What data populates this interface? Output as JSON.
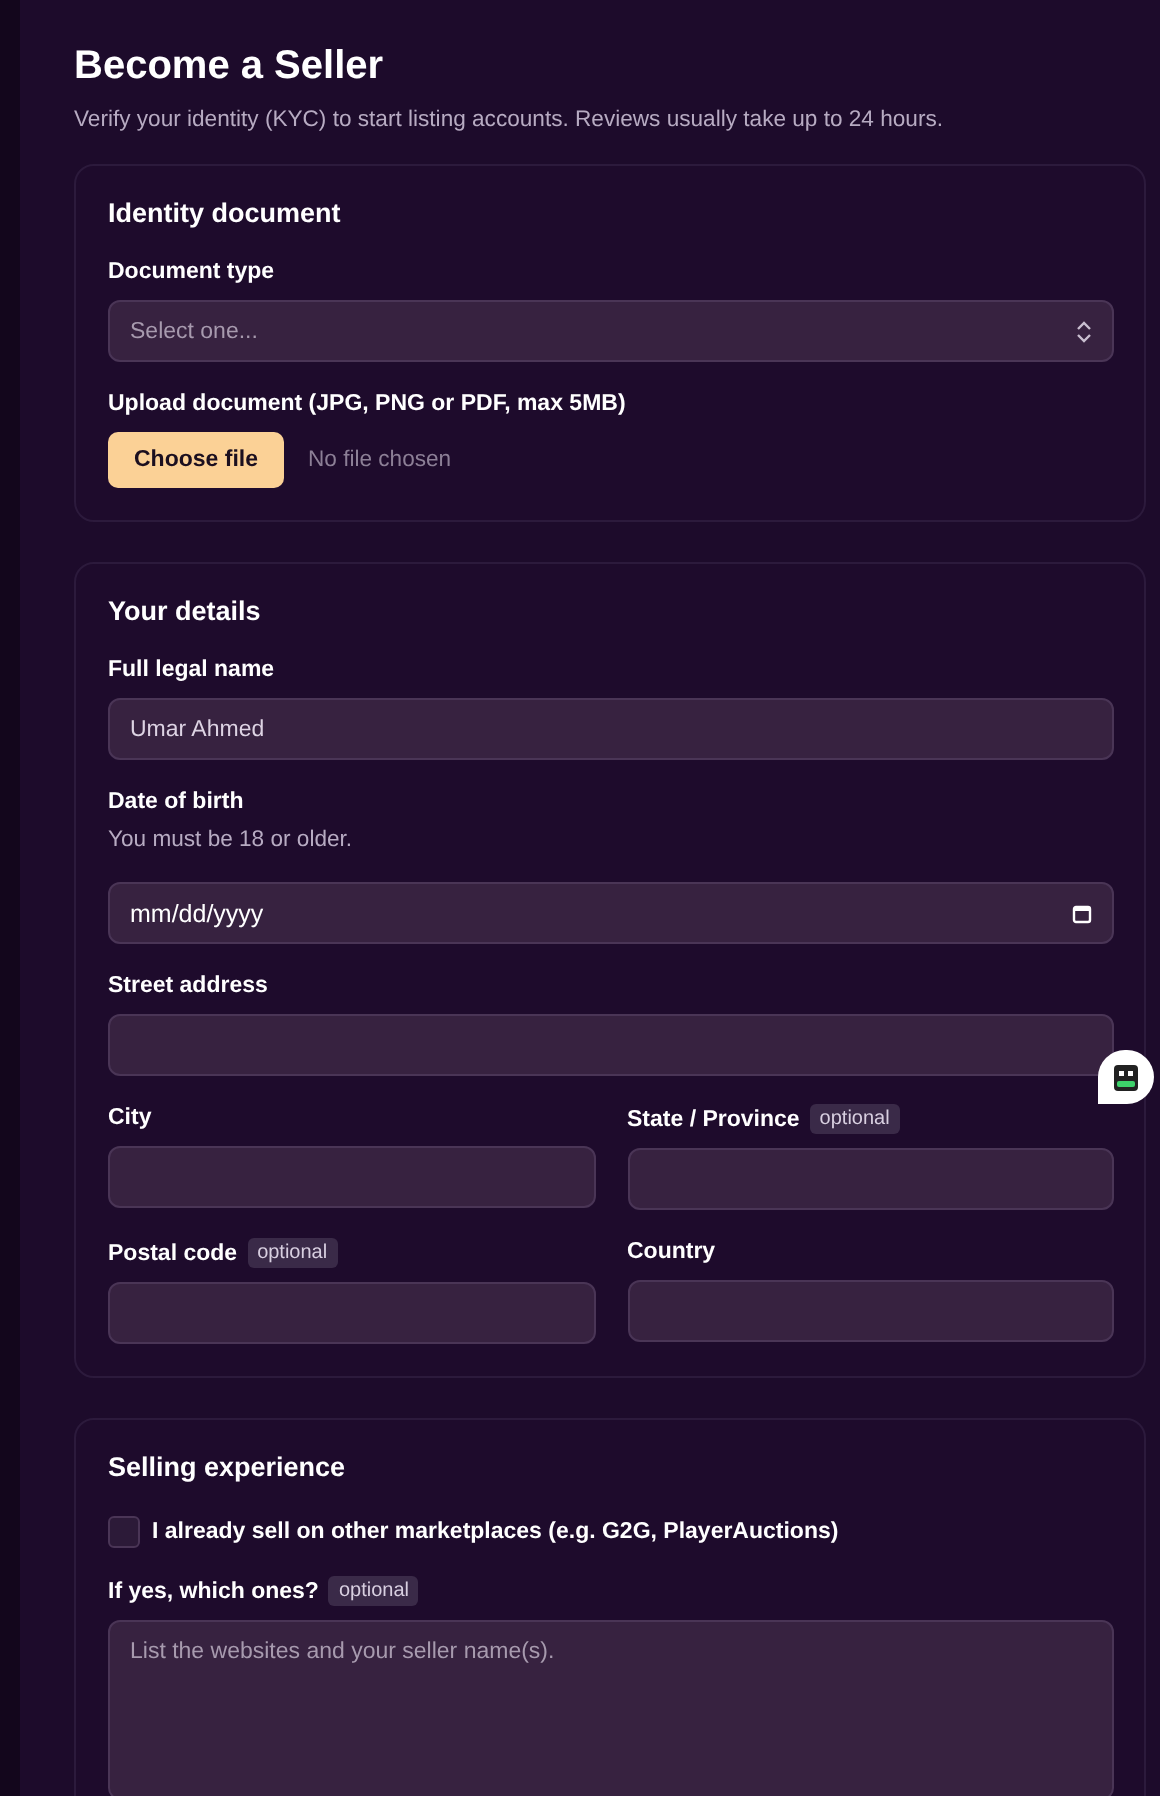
{
  "title": "Become a Seller",
  "subtitle": "Verify your identity (KYC) to start listing accounts. Reviews usually take up to 24 hours.",
  "sections": [
    {
      "title": "Identity document",
      "rows": [
        [
          {
            "kind": "select",
            "label": "Document type",
            "placeholder": "Select one..."
          }
        ],
        [
          {
            "kind": "file",
            "label": "Upload document (JPG, PNG or PDF, max 5MB)",
            "button": "Choose file",
            "status": "No file chosen"
          }
        ]
      ]
    },
    {
      "title": "Your details",
      "rows": [
        [
          {
            "kind": "text",
            "label": "Full legal name",
            "value": "Umar Ahmed"
          }
        ],
        [
          {
            "kind": "date",
            "label": "Date of birth",
            "hint": "You must be 18 or older.",
            "placeholder": "mm/dd/yyyy"
          }
        ],
        [
          {
            "kind": "text",
            "label": "Street address"
          }
        ],
        [
          {
            "kind": "text",
            "label": "City"
          },
          {
            "kind": "text",
            "label": "State / Province",
            "badge": "optional"
          }
        ],
        [
          {
            "kind": "text",
            "label": "Postal code",
            "badge": "optional"
          },
          {
            "kind": "text",
            "label": "Country"
          }
        ]
      ]
    },
    {
      "title": "Selling experience",
      "rows": [
        [
          {
            "kind": "checkbox",
            "label": "I already sell on other marketplaces (e.g. G2G, PlayerAuctions)",
            "checked": false
          }
        ],
        [
          {
            "kind": "textarea",
            "label": "If yes, which ones?",
            "badge": "optional",
            "placeholder": "List the websites and your seller name(s)."
          }
        ]
      ]
    }
  ]
}
